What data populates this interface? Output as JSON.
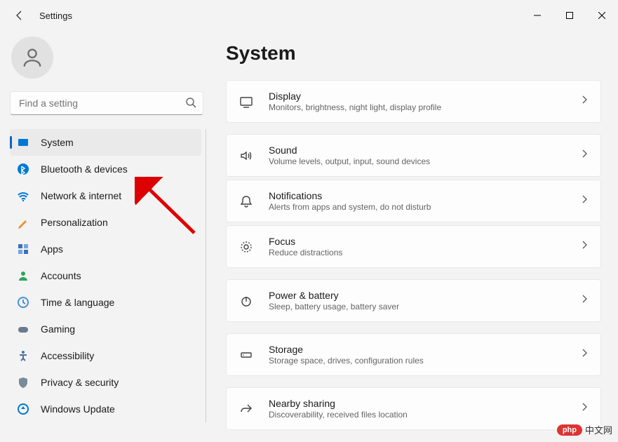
{
  "window": {
    "title": "Settings"
  },
  "search": {
    "placeholder": "Find a setting"
  },
  "sidebar": {
    "items": [
      {
        "label": "System",
        "icon": "system",
        "color": "#0078d4",
        "active": true
      },
      {
        "label": "Bluetooth & devices",
        "icon": "bluetooth",
        "color": "#0078d4"
      },
      {
        "label": "Network & internet",
        "icon": "wifi",
        "color": "#0078d4"
      },
      {
        "label": "Personalization",
        "icon": "brush",
        "color": "#e8912d"
      },
      {
        "label": "Apps",
        "icon": "apps",
        "color": "#3a6fbf"
      },
      {
        "label": "Accounts",
        "icon": "account",
        "color": "#2fa35a"
      },
      {
        "label": "Time & language",
        "icon": "clock",
        "color": "#4a90d9"
      },
      {
        "label": "Gaming",
        "icon": "gaming",
        "color": "#6b7a8f"
      },
      {
        "label": "Accessibility",
        "icon": "accessibility",
        "color": "#4a6fa5"
      },
      {
        "label": "Privacy & security",
        "icon": "shield",
        "color": "#7a8a99"
      },
      {
        "label": "Windows Update",
        "icon": "update",
        "color": "#0078d4"
      }
    ]
  },
  "page": {
    "title": "System",
    "cards": [
      {
        "icon": "display",
        "title": "Display",
        "subtitle": "Monitors, brightness, night light, display profile"
      },
      {
        "icon": "sound",
        "title": "Sound",
        "subtitle": "Volume levels, output, input, sound devices"
      },
      {
        "icon": "bell",
        "title": "Notifications",
        "subtitle": "Alerts from apps and system, do not disturb"
      },
      {
        "icon": "focus",
        "title": "Focus",
        "subtitle": "Reduce distractions"
      },
      {
        "icon": "power",
        "title": "Power & battery",
        "subtitle": "Sleep, battery usage, battery saver"
      },
      {
        "icon": "storage",
        "title": "Storage",
        "subtitle": "Storage space, drives, configuration rules"
      },
      {
        "icon": "share",
        "title": "Nearby sharing",
        "subtitle": "Discoverability, received files location"
      }
    ]
  },
  "watermark": {
    "logo": "php",
    "text": "中文网"
  }
}
